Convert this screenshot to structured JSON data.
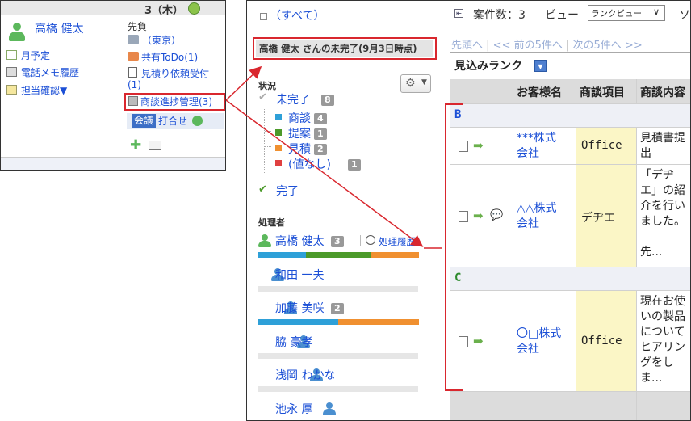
{
  "cal": {
    "date": "3（木）",
    "user": "高橋 健太",
    "links": [
      "月予定",
      "電話メモ履歴",
      "担当確認▼"
    ],
    "destination": "先負",
    "location": "（東京）",
    "items": [
      "共有ToDo(1)",
      "見積り依頼受付",
      "(1)",
      "商談進捗管理(3)"
    ],
    "meeting_tag": "会議",
    "meeting_text": "打合せ"
  },
  "center": {
    "all_link": "（すべて）",
    "header": "高橋 健太 さんの未完了(9月3日時点)",
    "status_title": "状況",
    "incomplete": "未完了",
    "incomplete_count": "8",
    "statuses": [
      {
        "label": "商談",
        "count": "4",
        "color": "#2ea0d8"
      },
      {
        "label": "提案",
        "count": "1",
        "color": "#4c9a2a"
      },
      {
        "label": "見積",
        "count": "2",
        "color": "#f09030"
      },
      {
        "label": "(値なし)",
        "count": "1",
        "color": "#e04040"
      }
    ],
    "complete": "完了",
    "handler_title": "処理者",
    "history_link": "処理履歴",
    "handlers": [
      {
        "name": "高橋 健太",
        "count": "3",
        "shares": [
          0.3,
          0.4,
          0.3
        ]
      },
      {
        "name": "和田 一夫",
        "count": "",
        "shares": []
      },
      {
        "name": "加藤 美咲",
        "count": "2",
        "shares": [
          0.5,
          0.5
        ]
      },
      {
        "name": "脇 豪孝",
        "count": "",
        "shares": []
      },
      {
        "name": "浅岡 わかな",
        "count": "",
        "shares": []
      },
      {
        "name": "池永 厚",
        "count": "",
        "shares": []
      }
    ]
  },
  "right": {
    "case_count": "案件数：3",
    "view_label": "ビュー",
    "view_value": "ランクビュー",
    "extra": "ソ",
    "nav": [
      "先頭へ",
      "<< 前の5件へ",
      "次の5件へ >>"
    ],
    "section_title": "見込みランク",
    "columns": [
      "お客様名",
      "商談項目",
      "商談内容"
    ],
    "groups": [
      {
        "rank": "B",
        "rows": [
          {
            "customer": [
              "***株式",
              "会社"
            ],
            "item": "Office",
            "content": [
              "見積書提",
              "出"
            ],
            "comment": false
          },
          {
            "customer": [
              "△△株式",
              "会社"
            ],
            "item": "デヂエ",
            "content": [
              "「デヂ",
              "エ」の紹",
              "介を行い",
              "ました。",
              "",
              "先..."
            ],
            "comment": true
          }
        ]
      },
      {
        "rank": "C",
        "rows": [
          {
            "customer": [
              "〇□株式",
              "会社"
            ],
            "item": "Office",
            "content": [
              "現在お使",
              "いの製品",
              "について",
              "ヒアリン",
              "グをし",
              "ま..."
            ],
            "comment": false
          }
        ]
      }
    ]
  }
}
